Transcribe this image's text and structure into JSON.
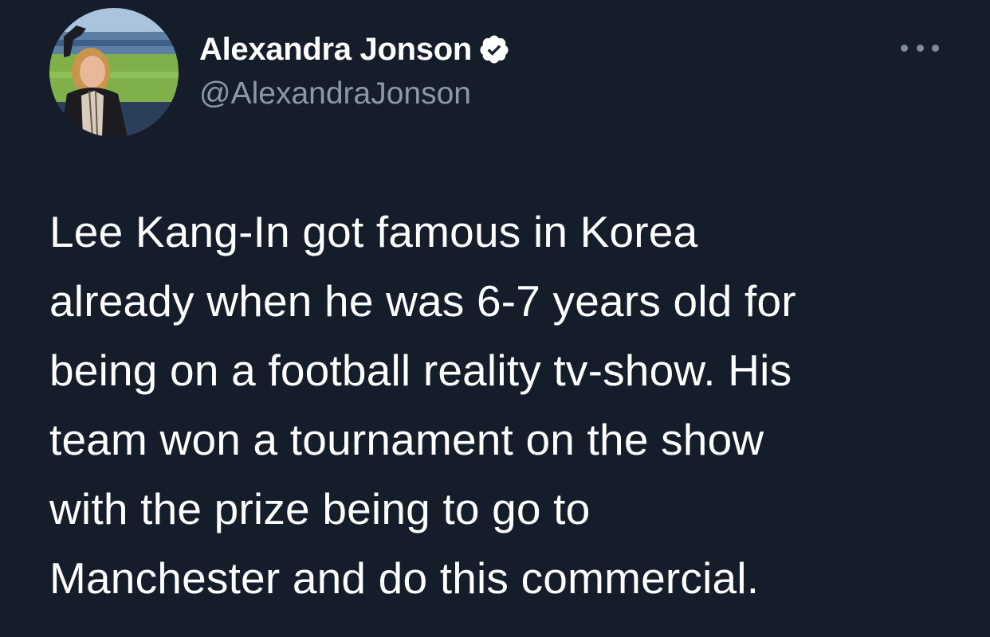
{
  "tweet": {
    "author": {
      "display_name": "Alexandra Jonson",
      "handle": "@AlexandraJonson",
      "verified": true
    },
    "text_lines": [
      "Lee Kang-In got famous in Korea",
      "already when he was 6-7 years old for",
      "being on a football reality tv-show. His",
      "team won a tournament on the show",
      "with the prize being to go to",
      "Manchester and do this commercial."
    ]
  },
  "icons": {
    "verified": "verified-badge-icon",
    "more": "more-options-icon"
  },
  "colors": {
    "background": "#161d2a",
    "text_primary": "#ffffff",
    "text_secondary": "#8b98a5"
  }
}
